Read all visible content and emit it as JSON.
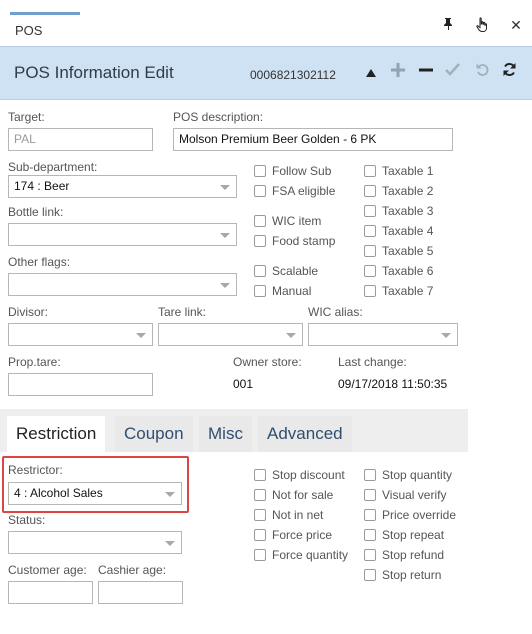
{
  "window": {
    "tab_label": "POS",
    "pin_icon": "pin-icon",
    "hand_icon": "hand-pointer-icon",
    "close_icon": "close-icon"
  },
  "header": {
    "title": "POS Information Edit",
    "code": "0006821302112",
    "buttons": [
      "triangle-up-icon",
      "plus-icon",
      "minus-icon",
      "check-icon",
      "undo-icon",
      "refresh-icon"
    ]
  },
  "form": {
    "target_label": "Target:",
    "target_value": "PAL",
    "pos_desc_label": "POS description:",
    "pos_desc_value": "Molson Premium Beer Golden - 6 PK",
    "subdept_label": "Sub-department:",
    "subdept_value": "174 : Beer",
    "bottle_label": "Bottle link:",
    "bottle_value": "",
    "other_flags_label": "Other flags:",
    "other_flags_value": "",
    "divisor_label": "Divisor:",
    "tare_link_label": "Tare link:",
    "wic_alias_label": "WIC alias:",
    "prop_tare_label": "Prop.tare:",
    "owner_store_label": "Owner store:",
    "owner_store_value": "001",
    "last_change_label": "Last change:",
    "last_change_value": "09/17/2018 11:50:35",
    "checks_col1": [
      "Follow Sub",
      "FSA eligible",
      "WIC item",
      "Food stamp",
      "Scalable",
      "Manual"
    ],
    "checks_col2": [
      "Taxable 1",
      "Taxable 2",
      "Taxable 3",
      "Taxable 4",
      "Taxable 5",
      "Taxable 6",
      "Taxable 7"
    ]
  },
  "tabs": [
    "Restriction",
    "Coupon",
    "Misc",
    "Advanced"
  ],
  "restriction": {
    "restrictor_label": "Restrictor:",
    "restrictor_value": "4 : Alcohol Sales",
    "status_label": "Status:",
    "status_value": "",
    "customer_age_label": "Customer age:",
    "cashier_age_label": "Cashier age:",
    "checks_col1": [
      "Stop discount",
      "Not for sale",
      "Not in net",
      "Force price",
      "Force quantity"
    ],
    "checks_col2": [
      "Stop quantity",
      "Visual verify",
      "Price override",
      "Stop repeat",
      "Stop refund",
      "Stop return"
    ]
  }
}
